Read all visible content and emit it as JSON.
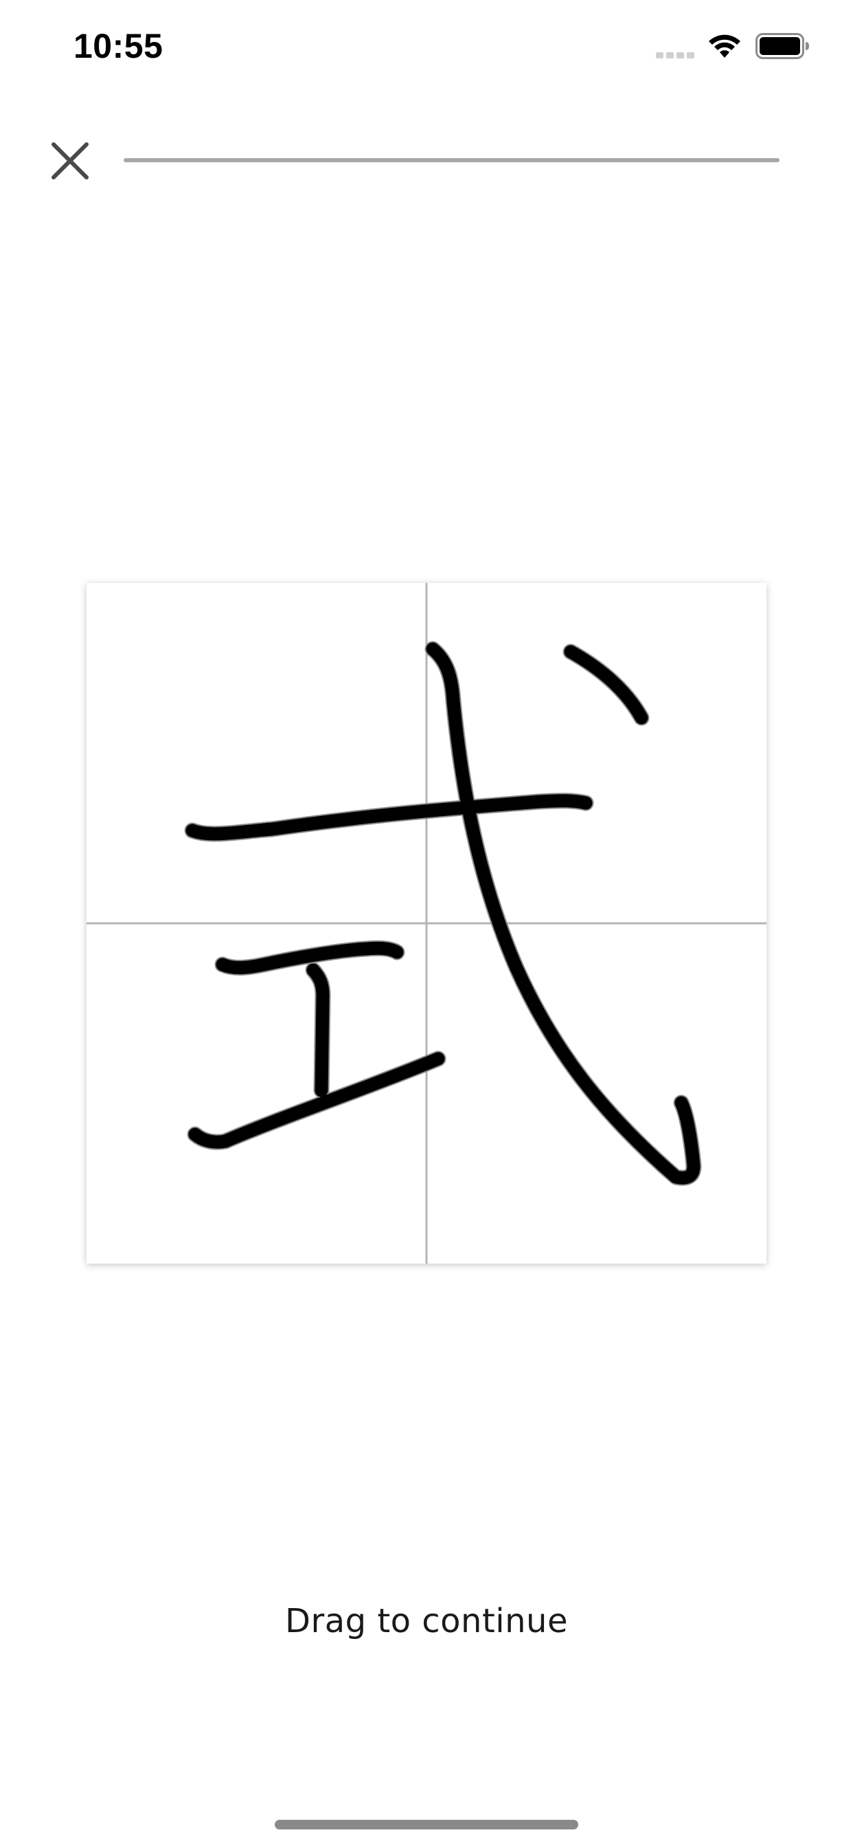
{
  "status_bar": {
    "time": "10:55",
    "icons": [
      "cellular-signal-icon",
      "wifi-icon",
      "battery-icon"
    ]
  },
  "header": {
    "close_icon": "close-icon",
    "progress_fraction": 0
  },
  "card": {
    "character": "式",
    "guide_lines": "cross",
    "stroke_color": "#000000",
    "guide_color": "#b5b5b5"
  },
  "hint": {
    "text": "Drag to continue"
  },
  "colors": {
    "background": "#ffffff",
    "progress_track": "#a8a8a8",
    "text": "#1a1a1a"
  }
}
